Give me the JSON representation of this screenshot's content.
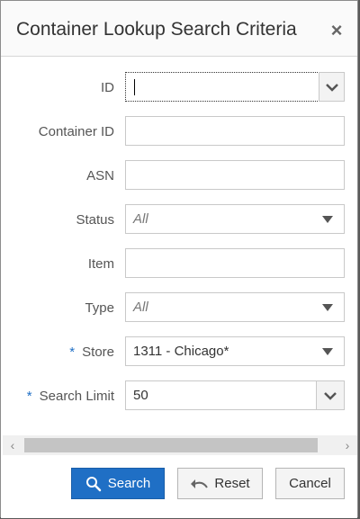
{
  "dialog": {
    "title": "Container Lookup Search Criteria",
    "close_glyph": "×"
  },
  "form": {
    "id": {
      "label": "ID",
      "value": ""
    },
    "container_id": {
      "label": "Container ID",
      "value": ""
    },
    "asn": {
      "label": "ASN",
      "value": ""
    },
    "status": {
      "label": "Status",
      "value": "All"
    },
    "item": {
      "label": "Item",
      "value": ""
    },
    "type": {
      "label": "Type",
      "value": "All"
    },
    "store": {
      "label": "Store",
      "required": "*",
      "value": "1311 - Chicago*"
    },
    "search_limit": {
      "label": "Search Limit",
      "required": "*",
      "value": "50"
    }
  },
  "buttons": {
    "search": "Search",
    "reset": "Reset",
    "cancel": "Cancel"
  },
  "icons": {
    "search": "search-icon",
    "reset": "undo-icon",
    "dropdown": "chevron-down-icon",
    "close": "close-icon"
  },
  "colors": {
    "accent": "#1f6fc5"
  }
}
